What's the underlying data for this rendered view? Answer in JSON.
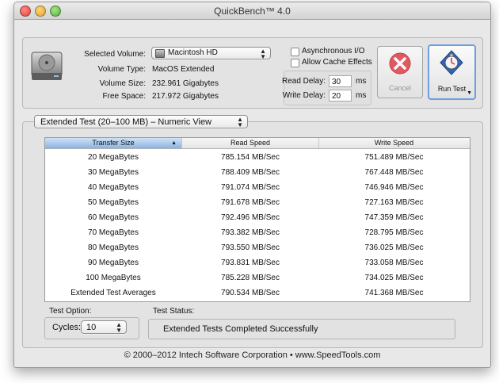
{
  "window": {
    "title": "QuickBench™ 4.0"
  },
  "drive": {
    "selected_volume_label": "Selected Volume:",
    "selected_volume_value": "Macintosh HD",
    "volume_type_label": "Volume Type:",
    "volume_type_value": "MacOS Extended",
    "volume_size_label": "Volume Size:",
    "volume_size_value": "232.961 Gigabytes",
    "free_space_label": "Free Space:",
    "free_space_value": "217.972 Gigabytes"
  },
  "options": {
    "async_io_label": "Asynchronous I/O",
    "async_io_checked": false,
    "cache_effects_label": "Allow Cache Effects",
    "cache_effects_checked": false,
    "read_delay_label": "Read Delay:",
    "read_delay_value": "30",
    "read_delay_unit": "ms",
    "write_delay_label": "Write Delay:",
    "write_delay_value": "20",
    "write_delay_unit": "ms"
  },
  "buttons": {
    "cancel_label": "Cancel",
    "cancel_icon": "cancel-x-icon",
    "run_test_label": "Run Test",
    "run_test_icon": "stopwatch-icon"
  },
  "test_view": {
    "selected": "Extended Test (20–100 MB) – Numeric View"
  },
  "table": {
    "columns": [
      "Transfer Size",
      "Read Speed",
      "Write Speed"
    ],
    "sorted_column": "Transfer Size",
    "rows": [
      [
        "20 MegaBytes",
        "785.154 MB/Sec",
        "751.489 MB/Sec"
      ],
      [
        "30 MegaBytes",
        "788.409 MB/Sec",
        "767.448 MB/Sec"
      ],
      [
        "40 MegaBytes",
        "791.074 MB/Sec",
        "746.946 MB/Sec"
      ],
      [
        "50 MegaBytes",
        "791.678 MB/Sec",
        "727.163 MB/Sec"
      ],
      [
        "60 MegaBytes",
        "792.496 MB/Sec",
        "747.359 MB/Sec"
      ],
      [
        "70 MegaBytes",
        "793.382 MB/Sec",
        "728.795 MB/Sec"
      ],
      [
        "80 MegaBytes",
        "793.550 MB/Sec",
        "736.025 MB/Sec"
      ],
      [
        "90 MegaBytes",
        "793.831 MB/Sec",
        "733.058 MB/Sec"
      ],
      [
        "100 MegaBytes",
        "785.228 MB/Sec",
        "734.025 MB/Sec"
      ],
      [
        "Extended Test Averages",
        "790.534 MB/Sec",
        "741.368 MB/Sec"
      ]
    ]
  },
  "test_option": {
    "label": "Test Option:",
    "cycles_label": "Cycles:",
    "cycles_value": "10"
  },
  "test_status": {
    "label": "Test Status:",
    "value": "Extended Tests Completed Successfully"
  },
  "footer": {
    "copyright": "© 2000–2012 Intech Software Corporation • www.SpeedTools.com"
  },
  "colors": {
    "accent_blue": "#8db3e0",
    "cancel_red": "#e2404a",
    "window_bg": "#e8e8e8"
  }
}
